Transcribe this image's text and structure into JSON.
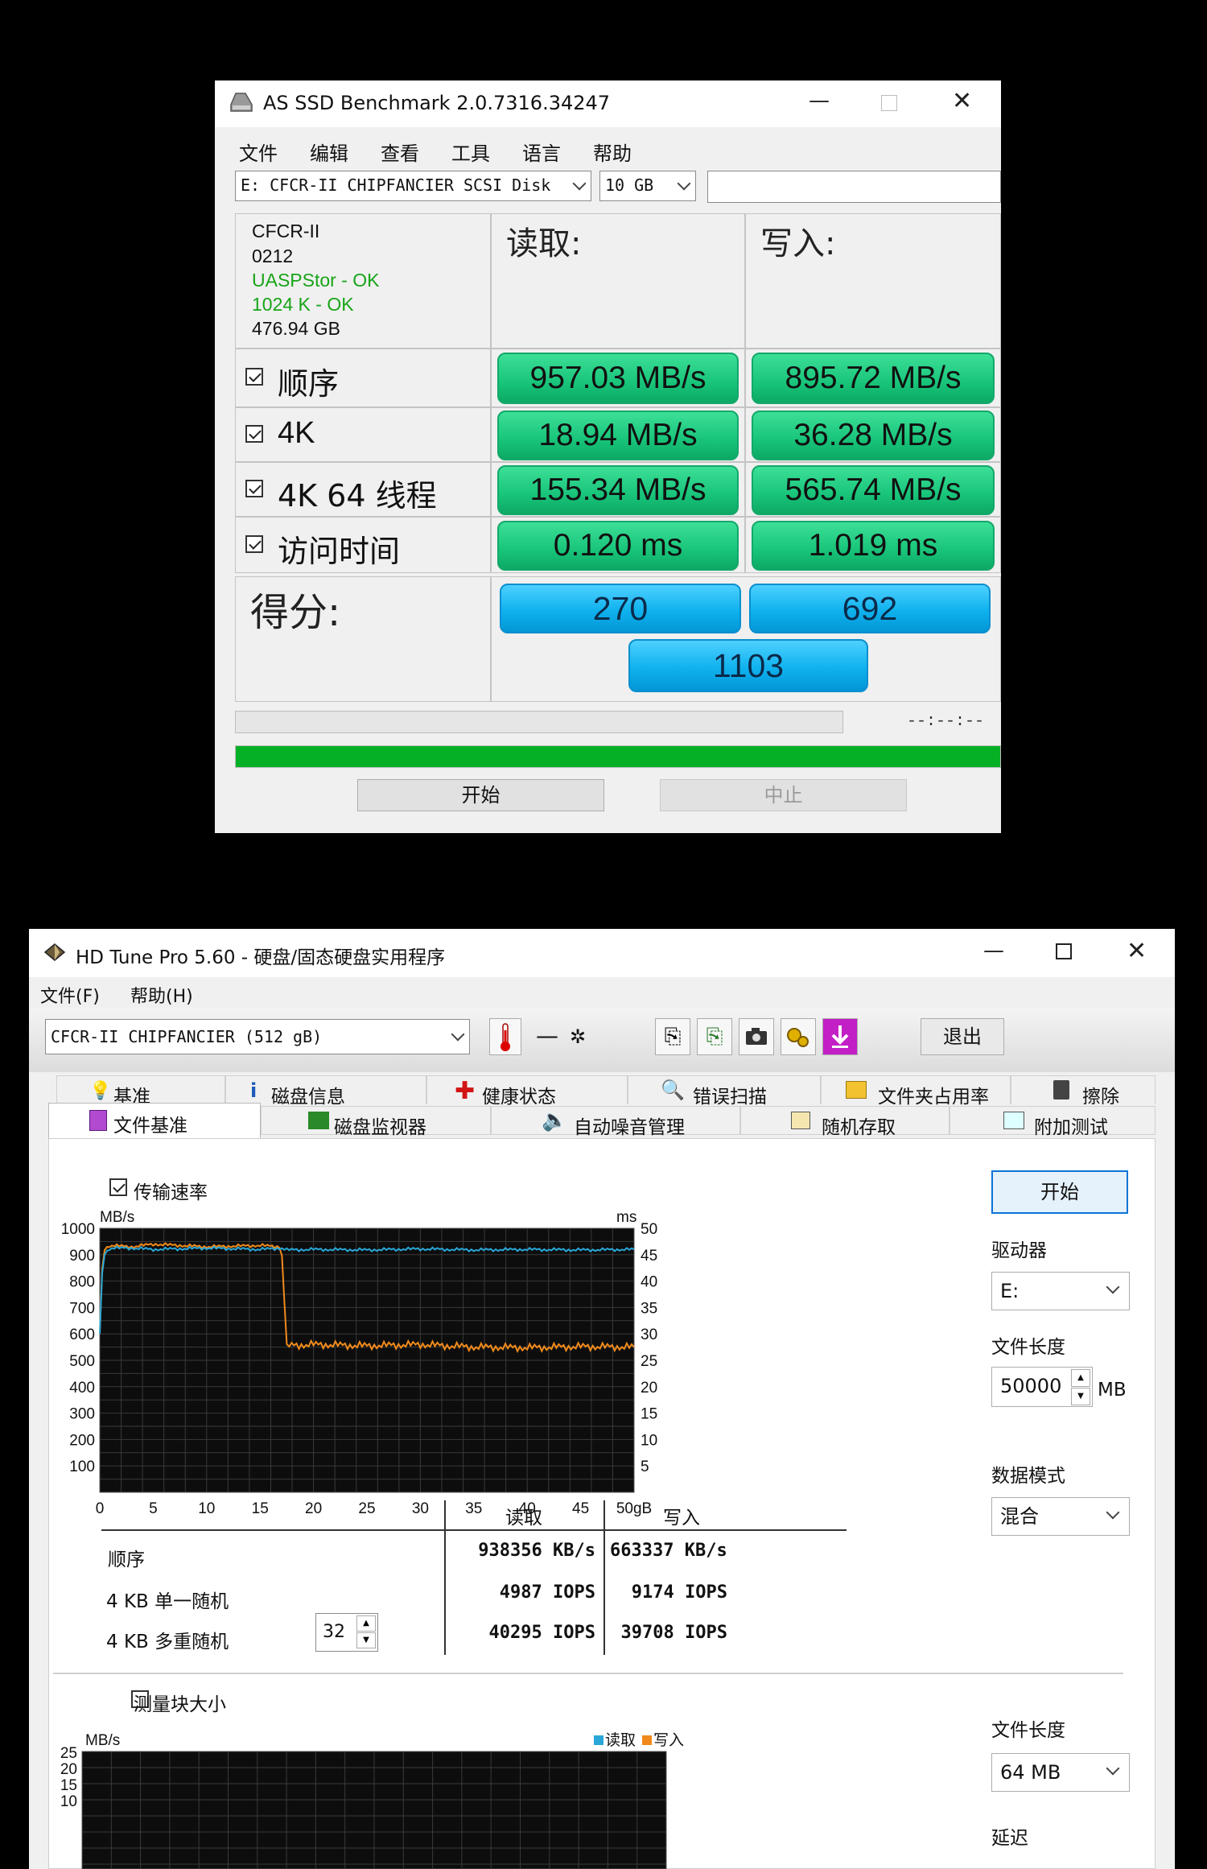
{
  "as_ssd": {
    "title": "AS SSD Benchmark 2.0.7316.34247",
    "menu": [
      "文件",
      "编辑",
      "查看",
      "工具",
      "语言",
      "帮助"
    ],
    "drive_select": "E: CFCR-II CHIPFANCIER SCSI Disk",
    "size_select": "10 GB",
    "info": {
      "name": "CFCR-II",
      "firmware": "0212",
      "driver": "UASPStor - OK",
      "align": "1024 K - OK",
      "capacity": "476.94 GB"
    },
    "header_read": "读取:",
    "header_write": "写入:",
    "rows": [
      {
        "label": "顺序",
        "read": "957.03 MB/s",
        "write": "895.72 MB/s",
        "checked": true
      },
      {
        "label": "4K",
        "read": "18.94 MB/s",
        "write": "36.28 MB/s",
        "checked": true
      },
      {
        "label": "4K 64 线程",
        "read": "155.34 MB/s",
        "write": "565.74 MB/s",
        "checked": true
      },
      {
        "label": "访问时间",
        "read": "0.120 ms",
        "write": "1.019 ms",
        "checked": true
      }
    ],
    "score_label": "得分:",
    "score_read": "270",
    "score_write": "692",
    "score_total": "1103",
    "time_display": "--:--:--",
    "start_button": "开始",
    "stop_button": "中止",
    "progress_small": 0,
    "progress_main": 1.0
  },
  "hd_tune": {
    "title": "HD Tune Pro 5.60 - 硬盘/固态硬盘实用程序",
    "menu": [
      "文件(F)",
      "帮助(H)"
    ],
    "drive_select": "CFCR-II CHIPFANCIER (512 gB)",
    "temperature": "—",
    "exit_button": "退出",
    "tabs_row1": [
      "基准",
      "磁盘信息",
      "健康状态",
      "错误扫描",
      "文件夹占用率",
      "擦除"
    ],
    "tabs_row2": [
      "文件基准",
      "磁盘监视器",
      "自动噪音管理",
      "随机存取",
      "附加测试"
    ],
    "transfer_rate_label": "传输速率",
    "transfer_checked": true,
    "y_unit_left": "MB/s",
    "y_unit_right": "ms",
    "x_unit": "gB",
    "results_header_read": "读取",
    "results_header_write": "写入",
    "results": [
      {
        "label": "顺序",
        "read": "938356 KB/s",
        "write": "663337 KB/s"
      },
      {
        "label": "4 KB 单一随机",
        "read": "4987 IOPS",
        "write": "9174 IOPS"
      },
      {
        "label": "4 KB 多重随机",
        "read": "40295 IOPS",
        "write": "39708 IOPS"
      }
    ],
    "queue_depth": "32",
    "side": {
      "start_button": "开始",
      "drive_label": "驱动器",
      "drive_value": "E:",
      "file_length_label": "文件长度",
      "file_length_value": "50000",
      "file_length_unit": "MB",
      "data_mode_label": "数据模式",
      "data_mode_value": "混合",
      "file_length_label2": "文件长度",
      "file_length_value2": "64 MB",
      "delay_label": "延迟"
    },
    "block_size_label": "测量块大小",
    "block_size_checked": false,
    "lower_y_unit": "MB/s",
    "legend_read": "读取",
    "legend_write": "写入",
    "colors": {
      "read": "#2aa7d8",
      "write": "#f08a1c",
      "grid": "#3a3a3a"
    }
  },
  "chart_data": [
    {
      "type": "line",
      "x_range": [
        0,
        50
      ],
      "x_unit": "gB",
      "x_ticks": [
        0,
        5,
        10,
        15,
        20,
        25,
        30,
        35,
        40,
        45,
        50
      ],
      "ylabel": "MB/s",
      "ylim": [
        0,
        1000
      ],
      "y_ticks": [
        100,
        200,
        300,
        400,
        500,
        600,
        700,
        800,
        900,
        1000
      ],
      "y2label": "ms",
      "y2lim": [
        0,
        50
      ],
      "y2_ticks": [
        5,
        10,
        15,
        20,
        25,
        30,
        35,
        40,
        45,
        50
      ],
      "grid": true,
      "series": [
        {
          "name": "读取",
          "color": "#2aa7d8",
          "x": [
            0,
            0.3,
            1,
            3,
            5,
            10,
            15,
            17,
            17.5,
            20,
            25,
            30,
            35,
            40,
            45,
            50
          ],
          "y": [
            600,
            900,
            925,
            925,
            920,
            925,
            920,
            925,
            918,
            920,
            918,
            922,
            918,
            920,
            918,
            920
          ]
        },
        {
          "name": "写入",
          "color": "#f08a1c",
          "x": [
            0,
            0.3,
            1,
            3,
            5,
            10,
            15,
            17,
            17.5,
            20,
            25,
            30,
            35,
            40,
            45,
            50
          ],
          "y": [
            600,
            920,
            935,
            930,
            940,
            930,
            935,
            930,
            555,
            560,
            555,
            560,
            550,
            548,
            552,
            550
          ]
        }
      ]
    },
    {
      "type": "line",
      "ylabel": "MB/s",
      "y_ticks": [
        10,
        15,
        20,
        25
      ],
      "grid": true,
      "series": [
        {
          "name": "读取",
          "color": "#2aa7d8",
          "values": []
        },
        {
          "name": "写入",
          "color": "#f08a1c",
          "values": []
        }
      ]
    }
  ]
}
